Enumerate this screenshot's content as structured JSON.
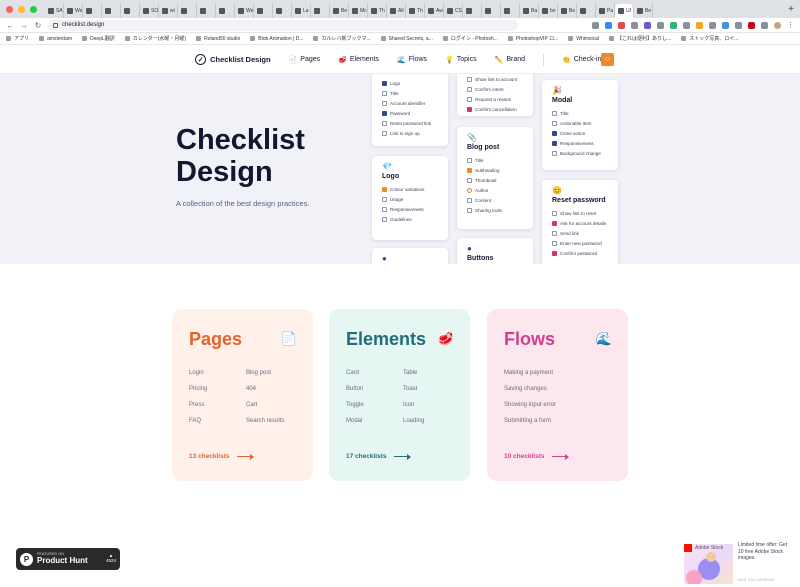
{
  "browser": {
    "tabs": [
      "SA",
      "We",
      "",
      "",
      "",
      "SO",
      "wi",
      "",
      "",
      "",
      "We",
      "",
      "",
      "La",
      "",
      "Be",
      "Mc",
      "Th",
      "All",
      "Th",
      "Aw",
      "CS",
      "",
      "",
      "",
      "Ba",
      "bo",
      "Be",
      "",
      "Pa",
      "UI",
      "Be"
    ],
    "active_tab_index": 30,
    "new_tab_label": "+",
    "url": "checklist.design",
    "bookmarks": [
      "アプリ",
      "amsterdam",
      "DeepL翻訳",
      "カレンダー(水曜・月曜)",
      "Roland50 studio",
      "Blob Animation | D...",
      "カルレバ新ブックマ...",
      "Shared Secrets, a...",
      "ログイン - Photosh...",
      "PhotoshopVIP ロ...",
      "Whimsical",
      "【これは便利】ありし...",
      "ストック写真、ロイ..."
    ]
  },
  "nav": {
    "brand": "Checklist Design",
    "links": [
      {
        "icon": "📄",
        "label": "Pages"
      },
      {
        "icon": "🥩",
        "label": "Elements"
      },
      {
        "icon": "🌊",
        "label": "Flows"
      },
      {
        "icon": "💡",
        "label": "Topics"
      },
      {
        "icon": "✏️",
        "label": "Brand"
      },
      {
        "icon": "👏",
        "label": "Check-ins"
      }
    ]
  },
  "hero": {
    "title": "Checklist Design",
    "subtitle": "A collection of the best design practices."
  },
  "preview_cards": {
    "card_a": {
      "title": "",
      "items": [
        "Logo",
        "Title",
        "Account identifier",
        "Password",
        "Reset password link",
        "Link to sign up"
      ]
    },
    "logo": {
      "icon": "💎",
      "title": "Logo",
      "items": [
        "Colour variations",
        "Usage",
        "Responsiveness",
        "Guidelines"
      ]
    },
    "card_c": {
      "title": "",
      "items": [
        "Show link to account",
        "Confirm intent",
        "Request a reason",
        "Confirm cancellation"
      ]
    },
    "blog_post": {
      "icon": "📎",
      "title": "Blog post",
      "items": [
        "Title",
        "Subheading",
        "Thumbnail",
        "Author",
        "Content",
        "Sharing tools"
      ]
    },
    "buttons": {
      "title": "Buttons"
    },
    "modal": {
      "icon": "🎉",
      "title": "Modal",
      "items": [
        "Title",
        "Actionable item",
        "Close action",
        "Responsiveness",
        "Background change"
      ]
    },
    "reset_password": {
      "icon": "😊",
      "title": "Reset password",
      "items": [
        "Show link to reset",
        "Ask for account details",
        "Send link",
        "Enter new password",
        "Confirm password"
      ]
    }
  },
  "categories": [
    {
      "title": "Pages",
      "emoji": "📄",
      "color": "#e8622b",
      "bg": "#fff1ea",
      "items": [
        "Login",
        "Blog post",
        "Pricing",
        "404",
        "Press",
        "Cart",
        "FAQ",
        "Search results"
      ],
      "count": "13 checklists"
    },
    {
      "title": "Elements",
      "emoji": "🥩",
      "color": "#1f6e7a",
      "bg": "#e6f6f3",
      "items": [
        "Card",
        "Table",
        "Button",
        "Toast",
        "Toggle",
        "Icon",
        "Modal",
        "Loading"
      ],
      "count": "17 checklists"
    },
    {
      "title": "Flows",
      "emoji": "🌊",
      "color": "#d23f8f",
      "bg": "#fde7ef",
      "items": [
        "Making a payment",
        "Saving changes",
        "Showing input error",
        "Submitting a form"
      ],
      "count": "10 checklists"
    }
  ],
  "product_hunt": {
    "featured": "FEATURED ON",
    "name": "Product Hunt",
    "votes": "4524"
  },
  "ad": {
    "brand": "Adobe Stock",
    "text": "Limited time offer: Get 10 free Adobe Stock images.",
    "via": "ADS VIA CARBON"
  },
  "colors": {
    "hero_bg": "#f1f2f8",
    "ink": "#141632",
    "accent_orange": "#f08a24"
  }
}
